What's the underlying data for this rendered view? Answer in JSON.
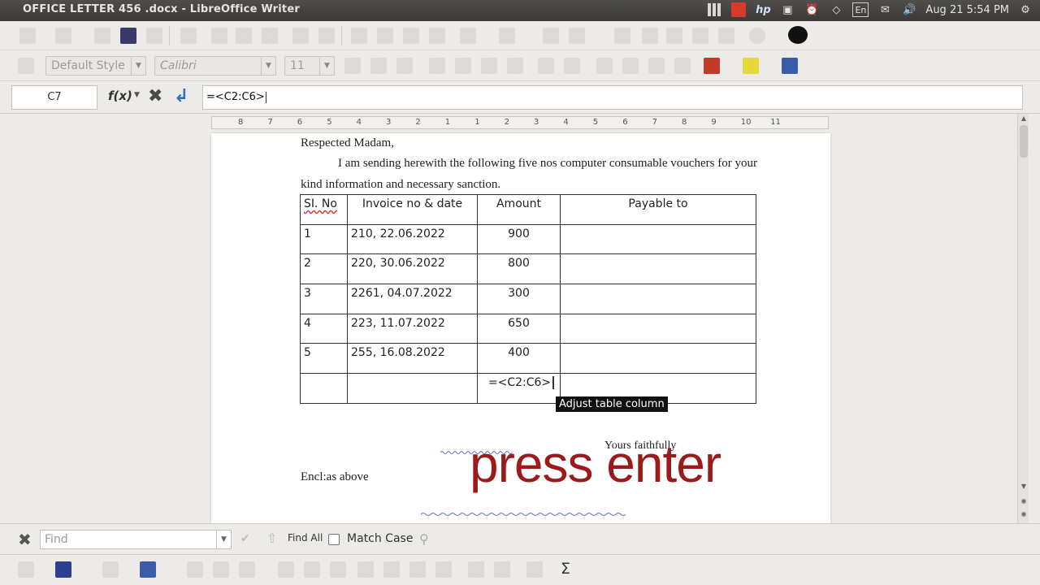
{
  "window": {
    "title": "OFFICE LETTER 456 .docx - LibreOffice Writer"
  },
  "system_tray": {
    "keyboard_layout": "En",
    "clock": "Aug 21  5:54 PM",
    "hp_label": "hp"
  },
  "formatting_toolbar": {
    "paragraph_style": "Default Style",
    "font_name": "Calibri",
    "font_size": "11"
  },
  "formula_bar": {
    "cell_reference": "C7",
    "fx_label": "f(x)",
    "formula": "=<C2:C6>"
  },
  "ruler": {
    "labels": [
      "8",
      "7",
      "6",
      "5",
      "4",
      "3",
      "2",
      "1",
      "1",
      "2",
      "3",
      "4",
      "5",
      "6",
      "7",
      "8",
      "9",
      "10",
      "11"
    ]
  },
  "document": {
    "salutation": "Respected Madam,",
    "body": "I am sending herewith the following five nos computer consumable vouchers for your kind information and necessary sanction.",
    "table": {
      "headers": [
        "SI. No",
        "Invoice no & date",
        "Amount",
        "Payable to"
      ],
      "rows": [
        [
          "1",
          "210, 22.06.2022",
          "900",
          ""
        ],
        [
          "2",
          "220, 30.06.2022",
          "800",
          ""
        ],
        [
          "3",
          "2261, 04.07.2022",
          "300",
          ""
        ],
        [
          "4",
          "223, 11.07.2022",
          "650",
          ""
        ],
        [
          "5",
          "255, 16.08.2022",
          "400",
          ""
        ]
      ],
      "total_formula": "=<C2:C6>"
    },
    "closing": "Yours faithfully",
    "enclosure": "Encl:as above"
  },
  "tooltip": "Adjust table column",
  "overlay_caption": "press enter",
  "find_bar": {
    "placeholder": "Find",
    "find_all_label": "Find All",
    "match_case_label": "Match Case"
  },
  "bottom_toolbar": {
    "sum_symbol": "Σ"
  },
  "colors": {
    "overlay_text": "#9b1b1b",
    "accept_icon": "#2e6fbf",
    "tooltip_bg": "#111111"
  }
}
